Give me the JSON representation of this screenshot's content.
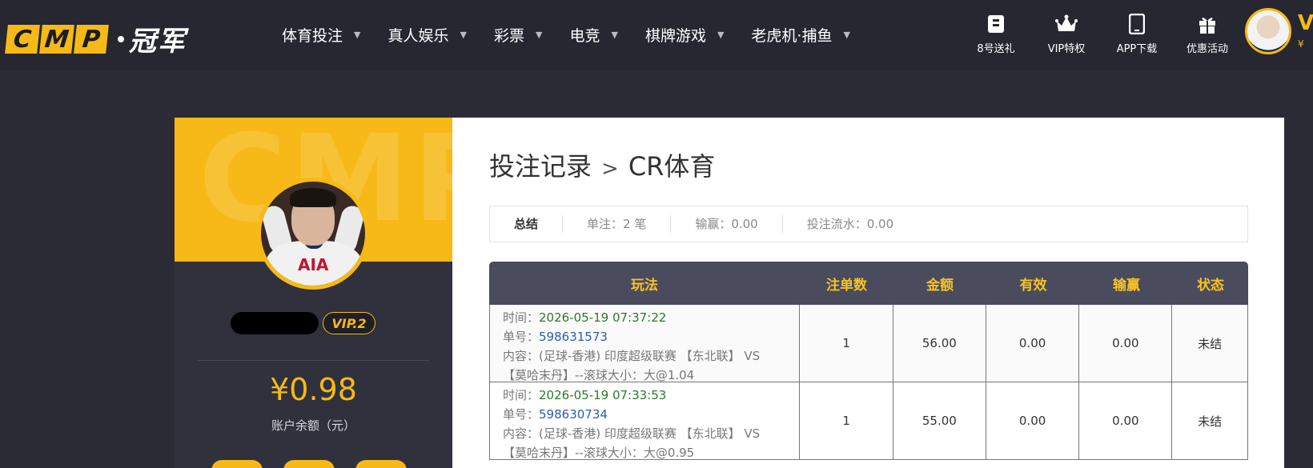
{
  "brand": {
    "letters": [
      "C",
      "M",
      "P"
    ],
    "cn_name": "冠军"
  },
  "nav": [
    {
      "label": "体育投注"
    },
    {
      "label": "真人娱乐"
    },
    {
      "label": "彩票"
    },
    {
      "label": "电竞"
    },
    {
      "label": "棋牌游戏"
    },
    {
      "label": "老虎机·捕鱼"
    }
  ],
  "tools": [
    {
      "label": "8号送礼",
      "icon": "gift-ticket-icon"
    },
    {
      "label": "VIP特权",
      "icon": "crown-icon"
    },
    {
      "label": "APP下载",
      "icon": "mobile-icon"
    },
    {
      "label": "优惠活动",
      "icon": "gift-box-icon"
    }
  ],
  "header_user": {
    "initial": "V",
    "balance_prefix": "¥"
  },
  "sidebar": {
    "watermark": "CMP",
    "vip": "VIP.2",
    "balance": "¥0.98",
    "balance_label": "账户余额（元）"
  },
  "page": {
    "crumb_parent": "投注记录",
    "crumb_sep": ">",
    "crumb_current": "CR体育"
  },
  "summary": {
    "label": "总结",
    "bets": "单注：2 笔",
    "winloss": "输赢：0.00",
    "turnover": "投注流水：0.00"
  },
  "table": {
    "headers": [
      "玩法",
      "注单数",
      "金额",
      "有效",
      "输赢",
      "状态"
    ],
    "rows": [
      {
        "time_label": "时间：",
        "time": "2026-05-19 07:37:22",
        "id_label": "单号：",
        "id": "598631573",
        "content_line1": "内容：(足球-香港) 印度超级联赛 【东北联】 VS",
        "content_line2": "【莫哈末丹】--滚球大小：大@1.04",
        "count": "1",
        "amount": "56.00",
        "valid": "0.00",
        "winloss": "0.00",
        "status": "未结"
      },
      {
        "time_label": "时间：",
        "time": "2026-05-19 07:33:53",
        "id_label": "单号：",
        "id": "598630734",
        "content_line1": "内容：(足球-香港) 印度超级联赛 【东北联】 VS",
        "content_line2": "【莫哈末丹】--滚球大小：大@0.95",
        "count": "1",
        "amount": "55.00",
        "valid": "0.00",
        "winloss": "0.00",
        "status": "未结"
      }
    ]
  }
}
